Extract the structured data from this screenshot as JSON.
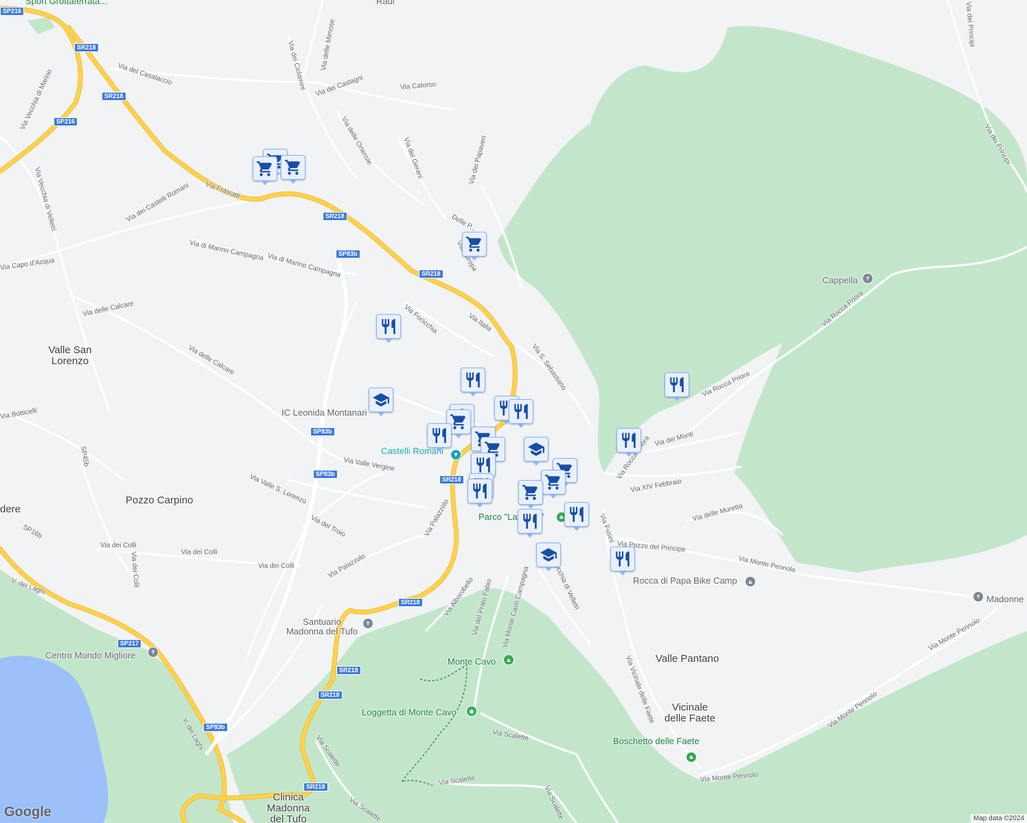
{
  "colors": {
    "land": "#f1f3f4",
    "park": "#c3e6cb",
    "water": "#9cc0f9",
    "highway": "#fcd34d",
    "road": "#ffffff",
    "marker_bg": "#e8f0fe",
    "marker_icon": "#174ea6"
  },
  "places": {
    "valle_san_lorenzo": "Valle San\nLorenzo",
    "pozzo_carpino": "Pozzo Carpino",
    "dere": "dere",
    "valle_pantano": "Valle Pantano",
    "vicinale_delle_faete": "Vicinale\ndelle Faete",
    "clinica": "Clinica\nMadonna\ndel Tufo"
  },
  "pois": {
    "sport": "Sport Grottaferrata...",
    "raul": "Raul",
    "ic_leonida": "IC Leonida Montanari",
    "castelli_romani": "Castelli Romani",
    "parco": "Parco \"La Pupa\"",
    "santuario": "Santuario\nMadonna del Tufo",
    "centro_mondo": "Centro Mondo Migliore",
    "monte_cavo": "Monte Cavo",
    "loggetta": "Loggetta di Monte Cavo",
    "boschetto": "Boschetto delle Faete",
    "cappella": "Cappella",
    "bike_camp": "Rocca di Papa Bike Camp",
    "madonne": "Madonne"
  },
  "roads": {
    "via_frascati": "Via Frascati",
    "via_casalaccio": "Via del Casalaccio",
    "via_vecchia_marino": "Via Vecchia di Marino",
    "via_vecchia_velletri": "Via Vecchia di Velletri",
    "via_castelli_romani": "Via dei Castelli Romani",
    "via_capo_acqua": "Via Capo d'Acqua",
    "via_marino_campagna1": "Via di Marino Campagna",
    "via_marino_campagna2": "Via di Marino Campagna",
    "via_calcare1": "Via delle Calcare",
    "via_calcare2": "Via delle Calcare",
    "via_botticelli": "Via Botticelli",
    "sp45b": "SP45b",
    "sp16b": "SP16b",
    "via_colli1": "Via dei Colli",
    "via_colli2": "Via dei Colli",
    "via_colli3": "Via dei Colli",
    "via_colli4": "Via dei Colli",
    "via_valle_lorenzo": "Via Valle S. Lorenzo",
    "via_troio": "Via del Troio",
    "via_palazzolo1": "Via Palazzolo",
    "via_palazzolo2": "Via Palazzolo",
    "via_valle_vergine": "Via Valle Vergine",
    "via_focicchia": "Via Focicchia",
    "via_italia": "Via Italia",
    "via_europa": "Via Europa",
    "delle_p": "Delle P...",
    "via_catorso": "Via Catorso",
    "via_castagni": "Via dei Castagni",
    "via_ciclamini": "Via dei Ciclamini",
    "via_mimose": "Via delle Mimose",
    "via_ortensie": "Via delle Ortensie",
    "via_gerani": "Via dei Gerani",
    "via_papaveri": "Via dei Papaveri",
    "via_s_sebastiano": "Via S. Sebastiano",
    "via_rocca_priora1": "Via Rocca Priora",
    "via_rocca_priora2": "Via Rocca Priora",
    "via_rocca_priora3": "Via Rocca Priora",
    "via_monti": "Via dei Monti",
    "via_xiv_febbraio": "Via XIV Febbraio",
    "via_muretta": "Via delle Muretta",
    "via_pozzo_principe": "Via Pozzo del Principe",
    "via_monte_pennolo1": "Via Monte Pennolo",
    "via_monte_pennolo2": "Via Monte Pennolo",
    "via_monte_pennolo3": "Via Monte Pennolo",
    "via_monte_pennolo4": "Via Monte Pennolo",
    "via_vecchia_velletri2": "Via Vecchia di Velletri",
    "via_vicinale_faete": "Via Vicinale delle Faete",
    "via_monte_cavo_campagna": "Via Monte Cavo Campagna",
    "via_prato_fabio": "Via del Prato Fabio",
    "via_alborobello": "Via Alborobello",
    "via_scalette1": "Via Scalette",
    "via_scalette2": "Via Scalette",
    "via_scalette3": "Via Scalette",
    "via_scalette4": "Via Scalette",
    "via_scalette5": "Via Scalette",
    "via_principi1": "Via dei Principi",
    "via_principi2": "Via dei Principi",
    "v_laghi1": "V. dei Laghi",
    "v_laghi2": "V. dei Laghi",
    "via_fusini": "Via Fusini"
  },
  "shields": {
    "sp216a": "SP216",
    "sp216b": "SP216",
    "sr218a": "SR218",
    "sr218b": "SR218",
    "sr218c": "SR218",
    "sr218d": "SR218",
    "sp83b_a": "SP83b",
    "sp83b_b": "SP83b",
    "sp83b_c": "SP83b",
    "sr218e": "SR218",
    "sr218f": "SR218",
    "sr218g": "SR218",
    "sr218h": "SR218",
    "sr218i": "SR218",
    "sp217": "SP217",
    "sp83b_d": "SP83b"
  },
  "markers": [
    "cart-icon",
    "cart-icon",
    "cart-icon",
    "cart-icon",
    "fork-knife-icon",
    "fork-knife-icon",
    "graduation-cap-icon",
    "fork-knife-icon",
    "fork-knife-icon",
    "shopping-bag-icon",
    "cart-icon",
    "fork-knife-icon",
    "cart-icon",
    "cart-icon",
    "graduation-cap-icon",
    "fork-knife-icon",
    "cart-icon",
    "cart-icon",
    "fork-knife-icon",
    "fork-knife-icon",
    "cart-icon",
    "fork-knife-icon",
    "fork-knife-icon",
    "graduation-cap-icon",
    "fork-knife-icon",
    "fork-knife-icon",
    "fork-knife-icon"
  ],
  "branding": {
    "logo": "Google",
    "attribution": "Map data ©2024"
  }
}
